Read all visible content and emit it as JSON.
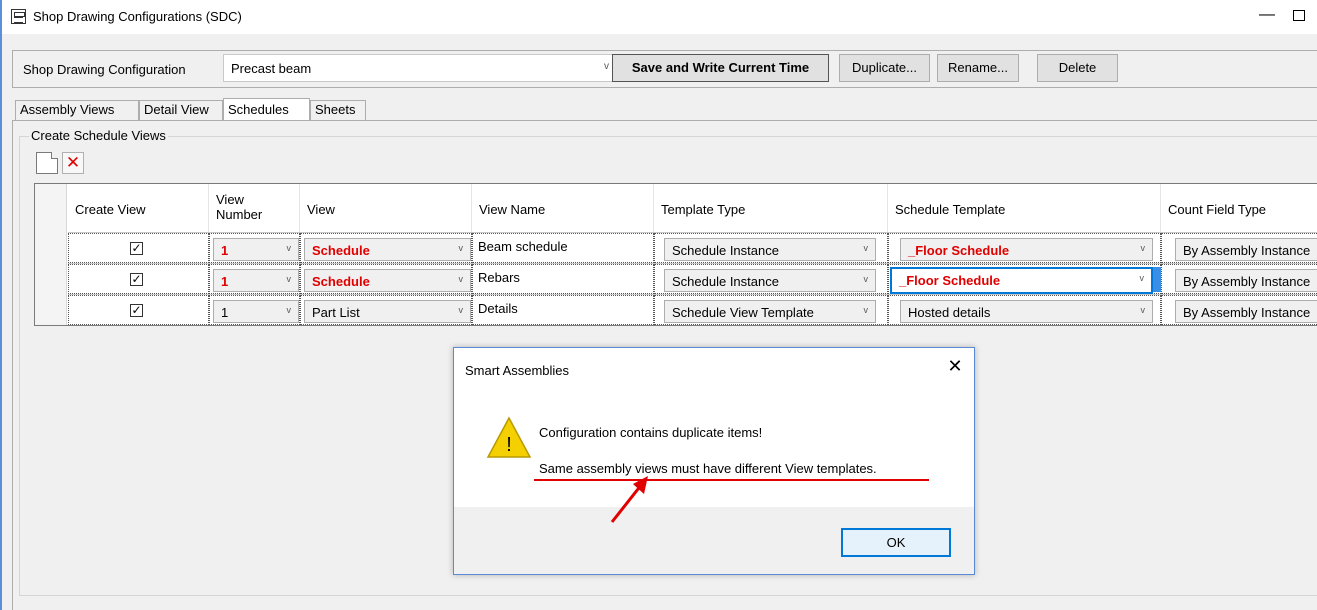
{
  "window": {
    "title": "Shop Drawing Configurations (SDC)",
    "minimize_glyph": "—"
  },
  "config_bar": {
    "label": "Shop Drawing Configuration",
    "selected": "Precast beam",
    "buttons": {
      "save": "Save and Write Current Time",
      "duplicate": "Duplicate...",
      "rename": "Rename...",
      "delete": "Delete"
    }
  },
  "tabs": [
    {
      "label": "Assembly Views",
      "active": false
    },
    {
      "label": "Detail View",
      "active": false
    },
    {
      "label": "Schedules",
      "active": true
    },
    {
      "label": "Sheets",
      "active": false
    }
  ],
  "group": {
    "label": "Create Schedule Views",
    "toolbar": {
      "delete_glyph": "✕"
    }
  },
  "grid": {
    "columns": {
      "create_view": "Create View",
      "view_number_1": "View",
      "view_number_2": "Number",
      "view": "View",
      "view_name": "View Name",
      "template_type": "Template Type",
      "schedule_template": "Schedule Template",
      "count_field_type": "Count Field Type"
    },
    "rows": [
      {
        "checked": "✓",
        "view_number": "1",
        "view": "Schedule",
        "view_name": "Beam schedule",
        "template_type": "Schedule Instance",
        "schedule_template": "_Floor Schedule",
        "count_field_type": "By Assembly Instance",
        "highlight": true
      },
      {
        "checked": "✓",
        "view_number": "1",
        "view": "Schedule",
        "view_name": "Rebars",
        "template_type": "Schedule Instance",
        "schedule_template": "_Floor Schedule",
        "count_field_type": "By Assembly Instance",
        "highlight": true
      },
      {
        "checked": "✓",
        "view_number": "1",
        "view": "Part List",
        "view_name": "Details",
        "template_type": "Schedule View Template",
        "schedule_template": "Hosted details",
        "count_field_type": "By Assembly Instance",
        "highlight": false
      }
    ],
    "caret": "v"
  },
  "dialog": {
    "title": "Smart Assemblies",
    "close_glyph": "✕",
    "message_line1": "Configuration contains duplicate items!",
    "message_line2": "Same assembly views must have different View templates.",
    "ok": "OK",
    "warning_glyph": "!"
  },
  "colors": {
    "error_red": "#e00000",
    "selection_blue": "#0078d7",
    "warning_yellow": "#f5d000"
  }
}
